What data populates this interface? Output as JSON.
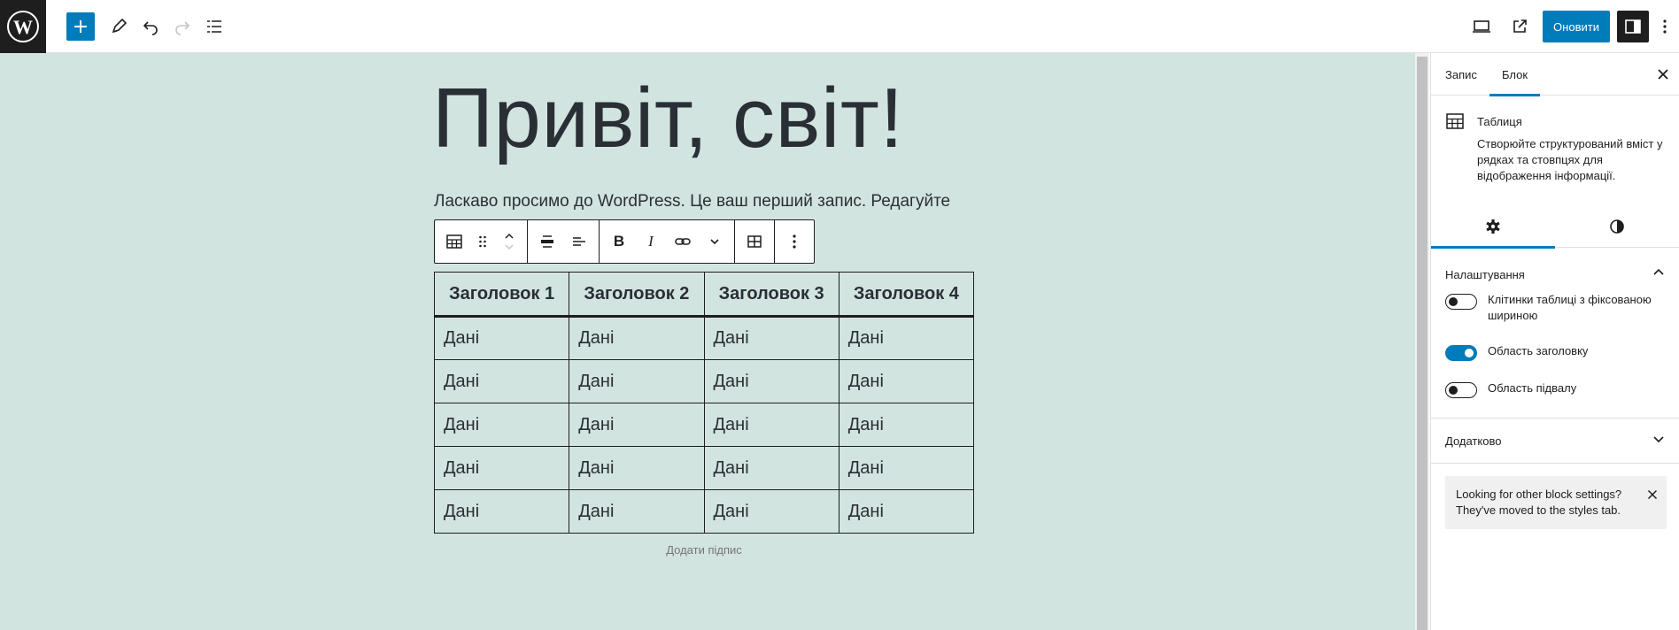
{
  "topbar": {
    "update_label": "Оновити"
  },
  "post": {
    "title": "Привіт, світ!",
    "paragraph": "Ласкаво просимо до WordPress. Це ваш перший запис. Редагуйте"
  },
  "table": {
    "headers": [
      "Заголовок 1",
      "Заголовок 2",
      "Заголовок 3",
      "Заголовок 4"
    ],
    "rows": [
      [
        "Дані",
        "Дані",
        "Дані",
        "Дані"
      ],
      [
        "Дані",
        "Дані",
        "Дані",
        "Дані"
      ],
      [
        "Дані",
        "Дані",
        "Дані",
        "Дані"
      ],
      [
        "Дані",
        "Дані",
        "Дані",
        "Дані"
      ],
      [
        "Дані",
        "Дані",
        "Дані",
        "Дані"
      ]
    ],
    "caption_placeholder": "Додати підпис"
  },
  "sidebar": {
    "tabs": [
      "Запис",
      "Блок"
    ],
    "active_tab": "Блок",
    "block": {
      "title": "Таблиця",
      "description": "Створюйте структурований вміст у рядках та стовпцях для відображення інформації."
    },
    "settings_panel": {
      "title": "Налаштування",
      "toggles": [
        {
          "label": "Клітинки таблиці з фіксованою шириною",
          "on": false
        },
        {
          "label": "Область заголовку",
          "on": true
        },
        {
          "label": "Область підвалу",
          "on": false
        }
      ]
    },
    "advanced_panel": {
      "title": "Додатково"
    },
    "notice": "Looking for other block settings? They've moved to the styles tab."
  },
  "colors": {
    "accent": "#007cba",
    "canvas_bg": "#d2e4df",
    "dark": "#1e1e1e"
  }
}
